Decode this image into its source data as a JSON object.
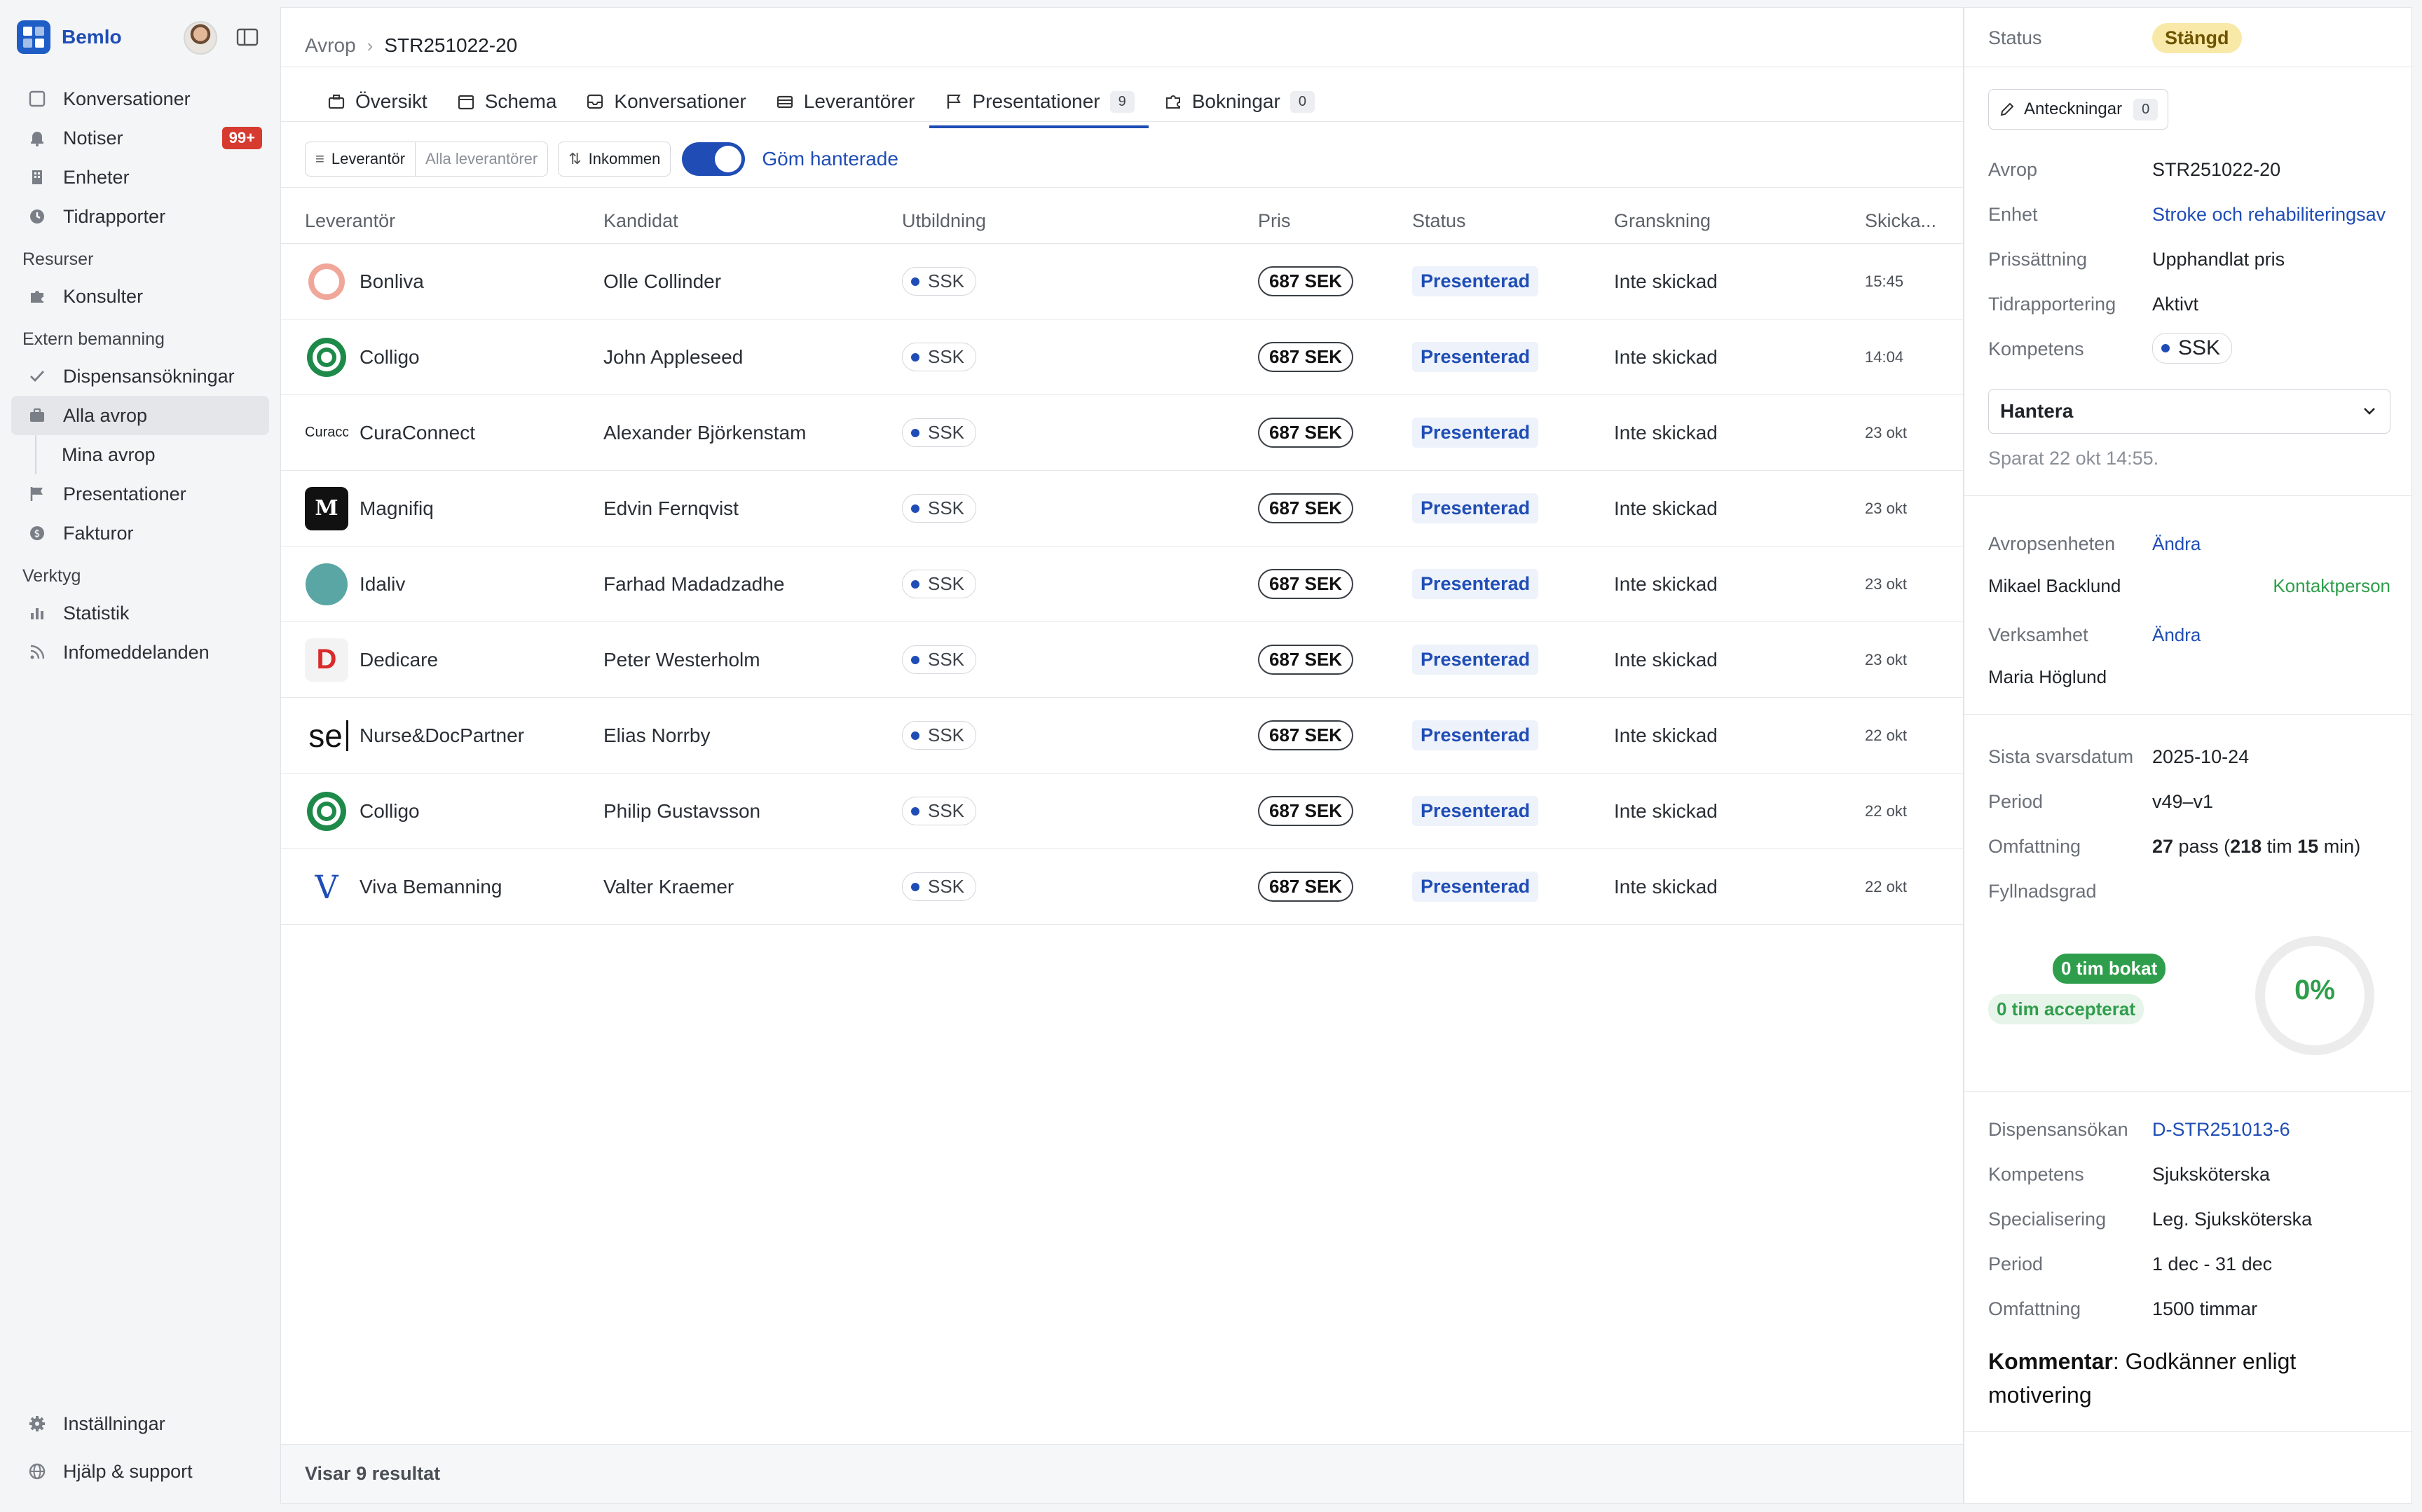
{
  "app": {
    "name": "Bemlo"
  },
  "sidebar": {
    "top_items": [
      {
        "label": "Konversationer",
        "icon": "inbox-icon"
      },
      {
        "label": "Notiser",
        "icon": "bell-icon",
        "badge": "99+"
      },
      {
        "label": "Enheter",
        "icon": "building-icon"
      },
      {
        "label": "Tidrapporter",
        "icon": "clock-icon"
      }
    ],
    "sections": [
      {
        "title": "Resurser",
        "items": [
          {
            "label": "Konsulter",
            "icon": "puzzle-icon"
          }
        ]
      },
      {
        "title": "Extern bemanning",
        "items": [
          {
            "label": "Dispensansökningar",
            "icon": "check-icon"
          },
          {
            "label": "Alla avrop",
            "icon": "briefcase-icon",
            "active": true
          },
          {
            "label": "Mina avrop",
            "icon": "",
            "sub": true
          },
          {
            "label": "Presentationer",
            "icon": "flag-icon"
          },
          {
            "label": "Fakturor",
            "icon": "dollar-icon"
          }
        ]
      },
      {
        "title": "Verktyg",
        "items": [
          {
            "label": "Statistik",
            "icon": "bar-chart-icon"
          },
          {
            "label": "Infomeddelanden",
            "icon": "rss-icon"
          }
        ]
      }
    ],
    "bottom_items": [
      {
        "label": "Inställningar",
        "icon": "gear-icon"
      },
      {
        "label": "Hjälp & support",
        "icon": "globe-icon"
      }
    ]
  },
  "breadcrumb": {
    "root": "Avrop",
    "current": "STR251022-20"
  },
  "tabs": [
    {
      "label": "Översikt",
      "icon": "briefcase-icon"
    },
    {
      "label": "Schema",
      "icon": "calendar-icon"
    },
    {
      "label": "Konversationer",
      "icon": "inbox-icon"
    },
    {
      "label": "Leverantörer",
      "icon": "table-icon"
    },
    {
      "label": "Presentationer",
      "icon": "flag-icon",
      "count": "9",
      "active": true
    },
    {
      "label": "Bokningar",
      "icon": "puzzle-icon",
      "count": "0"
    }
  ],
  "filters": {
    "segment_on": "Leverantör",
    "segment_off": "Alla leverantörer",
    "incoming": "Inkommen",
    "toggle_label": "Göm hanterade",
    "toggle_on": true
  },
  "table": {
    "headers": [
      "Leverantör",
      "Kandidat",
      "Utbildning",
      "Pris",
      "Status",
      "Granskning",
      "Skicka..."
    ],
    "rows": [
      {
        "supplier": "Bonliva",
        "logo": "bonliva-logo",
        "candidate": "Olle Collinder",
        "education": "SSK",
        "price": "687 SEK",
        "status": "Presenterad",
        "review": "Inte skickad",
        "sent": "15:45"
      },
      {
        "supplier": "Colligo",
        "logo": "colligo-logo",
        "candidate": "John Appleseed",
        "education": "SSK",
        "price": "687 SEK",
        "status": "Presenterad",
        "review": "Inte skickad",
        "sent": "14:04"
      },
      {
        "supplier": "CuraConnect",
        "logo": "curaconnect-logo",
        "logo_text": "Curacc",
        "candidate": "Alexander Björkenstam",
        "education": "SSK",
        "price": "687 SEK",
        "status": "Presenterad",
        "review": "Inte skickad",
        "sent": "23 okt"
      },
      {
        "supplier": "Magnifiq",
        "logo": "magnifiq-logo",
        "logo_text": "M",
        "candidate": "Edvin Fernqvist",
        "education": "SSK",
        "price": "687 SEK",
        "status": "Presenterad",
        "review": "Inte skickad",
        "sent": "23 okt"
      },
      {
        "supplier": "Idaliv",
        "logo": "idaliv-logo",
        "candidate": "Farhad Madadzadhe",
        "education": "SSK",
        "price": "687 SEK",
        "status": "Presenterad",
        "review": "Inte skickad",
        "sent": "23 okt"
      },
      {
        "supplier": "Dedicare",
        "logo": "dedicare-logo",
        "logo_text": "D",
        "candidate": "Peter Westerholm",
        "education": "SSK",
        "price": "687 SEK",
        "status": "Presenterad",
        "review": "Inte skickad",
        "sent": "23 okt"
      },
      {
        "supplier": "Nurse&DocPartner",
        "logo": "nursedoc-logo",
        "logo_text": "se",
        "candidate": "Elias Norrby",
        "education": "SSK",
        "price": "687 SEK",
        "status": "Presenterad",
        "review": "Inte skickad",
        "sent": "22 okt"
      },
      {
        "supplier": "Colligo",
        "logo": "colligo-logo",
        "candidate": "Philip Gustavsson",
        "education": "SSK",
        "price": "687 SEK",
        "status": "Presenterad",
        "review": "Inte skickad",
        "sent": "22 okt"
      },
      {
        "supplier": "Viva Bemanning",
        "logo": "viva-logo",
        "logo_text": "V",
        "candidate": "Valter Kraemer",
        "education": "SSK",
        "price": "687 SEK",
        "status": "Presenterad",
        "review": "Inte skickad",
        "sent": "22 okt"
      }
    ]
  },
  "footer": {
    "results": "Visar 9 resultat"
  },
  "panel": {
    "status_label": "Status",
    "status_value": "Stängd",
    "notes_label": "Anteckningar",
    "notes_count": "0",
    "details": [
      {
        "label": "Avrop",
        "value": "STR251022-20"
      },
      {
        "label": "Enhet",
        "value": "Stroke och rehabiliteringsav",
        "link": true
      },
      {
        "label": "Prissättning",
        "value": "Upphandlat pris"
      },
      {
        "label": "Tidrapportering",
        "value": "Aktivt"
      },
      {
        "label": "Kompetens",
        "value": "SSK",
        "chip": true
      }
    ],
    "select_value": "Hantera",
    "saved": "Sparat 22 okt 14:55.",
    "contacts": [
      {
        "role": "Avropsenheten",
        "action": "Ändra",
        "name": "Mikael Backlund",
        "tag": "Kontaktperson"
      },
      {
        "role": "Verksamhet",
        "action": "Ändra",
        "name": "Maria Höglund",
        "tag": ""
      }
    ],
    "deadline_label": "Sista svarsdatum",
    "deadline": "2025-10-24",
    "period_label": "Period",
    "period": "v49–v1",
    "scope_label": "Omfattning",
    "scope": {
      "pass": "27",
      "pass_word": " pass (",
      "hours": "218",
      "hours_word": " tim ",
      "minutes": "15",
      "minutes_word": " min)"
    },
    "fill_label": "Fyllnadsgrad",
    "booked": "0 tim bokat",
    "accepted": "0 tim accepterat",
    "fill_percent": "0%",
    "fill_fraction": 0,
    "dispensation": [
      {
        "label": "Dispensansökan",
        "value": "D-STR251013-6",
        "link": true
      },
      {
        "label": "Kompetens",
        "value": "Sjuksköterska"
      },
      {
        "label": "Specialisering",
        "value": "Leg. Sjuksköterska"
      },
      {
        "label": "Period",
        "value": "1 dec - 31 dec"
      },
      {
        "label": "Omfattning",
        "value": "1500 timmar"
      }
    ],
    "comment_label": "Kommentar",
    "comment": ": Godkänner enligt motivering"
  },
  "colors": {
    "accent": "#1f4db5",
    "badge": "#d73a2f",
    "status_yellow": "#f9e9a8",
    "green": "#2f9e4c"
  }
}
